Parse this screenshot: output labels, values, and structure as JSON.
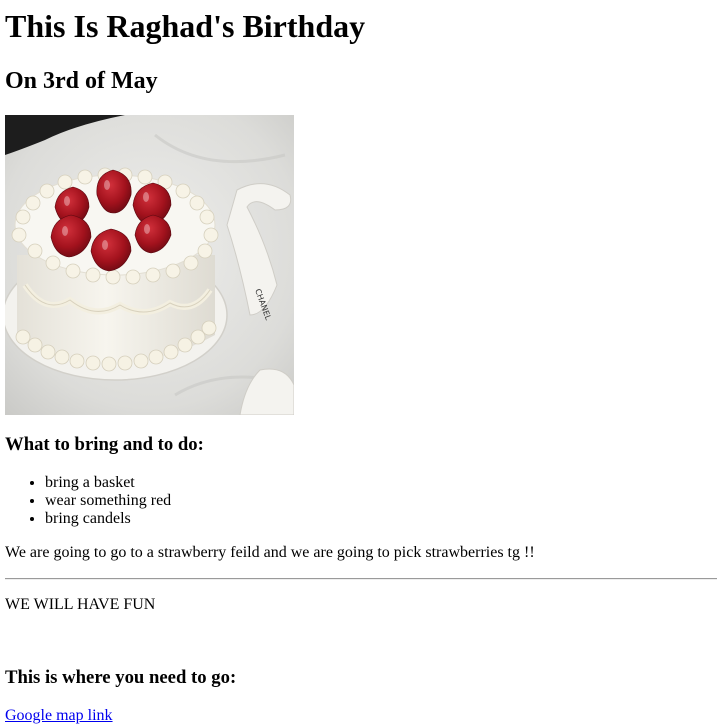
{
  "page": {
    "title": "This Is Raghad's Birthday",
    "subtitle": "On 3rd of May"
  },
  "image": {
    "icon": "cake-photo",
    "description_hidden": ""
  },
  "todo": {
    "heading": "What to bring and to do:",
    "items": [
      "bring a basket",
      "wear something red",
      "bring candels"
    ]
  },
  "plan_text": "We are going to go to a strawberry feild and we are going to pick strawberries tg !!",
  "fun_text": "WE WILL HAVE FUN",
  "location": {
    "heading": "This is where you need to go:",
    "link_label": "Google map link"
  },
  "colors": {
    "link": "#0000ee",
    "text": "#000000",
    "background": "#ffffff"
  }
}
